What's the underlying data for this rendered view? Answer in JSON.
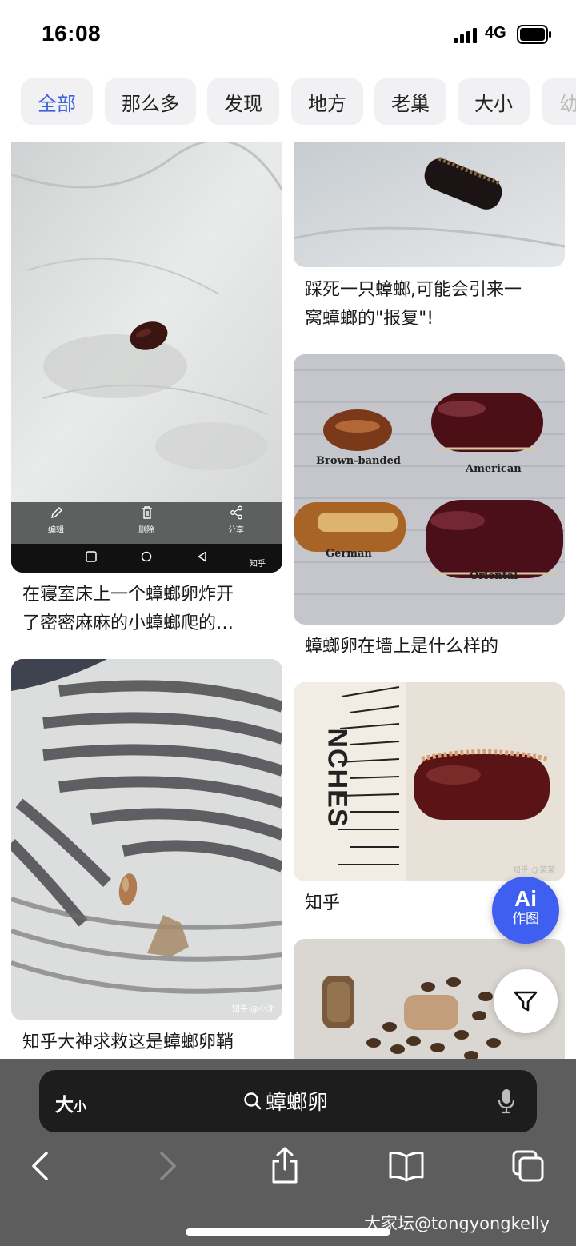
{
  "status": {
    "time": "16:08",
    "network": "4G"
  },
  "chips": [
    {
      "label": "全部",
      "active": true
    },
    {
      "label": "那么多",
      "active": false
    },
    {
      "label": "发现",
      "active": false
    },
    {
      "label": "地方",
      "active": false
    },
    {
      "label": "老巢",
      "active": false
    },
    {
      "label": "大小",
      "active": false
    },
    {
      "label": "幼",
      "active": false
    }
  ],
  "feed": {
    "left": [
      {
        "caption_line1": "在寝室床上一个蟑螂卵炸开",
        "caption_line2": "了密密麻麻的小蟑螂爬的…",
        "phone_toolbar": {
          "edit": "编辑",
          "delete": "删除",
          "share": "分享",
          "badge": "知乎"
        }
      },
      {
        "caption_line1": "知乎大神求救这是蟑螂卵鞘",
        "image_watermark": "知乎 @小沈"
      }
    ],
    "right": [
      {
        "caption_line1": "踩死一只蟑螂,可能会引来一",
        "caption_line2": "窝蟑螂的\"报复\"!"
      },
      {
        "caption_line1": "蟑螂卵在墙上是什么样的",
        "labels": {
          "brown_banded": "Brown-banded",
          "american": "American",
          "german": "German",
          "oriental": "Oriental"
        }
      },
      {
        "caption_line1": "知乎",
        "ruler_text": "NCHES",
        "image_watermark": "知乎 @某某"
      },
      {
        "caption_line1": ""
      }
    ]
  },
  "ai_button": {
    "line1": "Ai",
    "line2": "作图"
  },
  "address_bar": {
    "page_format": "大",
    "page_format_small": "小",
    "query": "蟑螂卵"
  },
  "watermark": "大家坛@tongyongkelly",
  "icons": {
    "edit": "pencil-icon",
    "delete": "trash-icon",
    "share": "share-icon",
    "filter": "filter-icon",
    "search": "search-icon",
    "mic": "microphone-icon",
    "back": "chevron-left-icon",
    "forward": "chevron-right-icon",
    "share_sheet": "share-icon",
    "bookmarks": "book-icon",
    "tabs": "tabs-icon"
  },
  "colors": {
    "accent": "#3d63e0",
    "ai_button": "#3f5ff0",
    "toolbar": "#5d5d5d",
    "address_bar": "#1d1d1d"
  }
}
